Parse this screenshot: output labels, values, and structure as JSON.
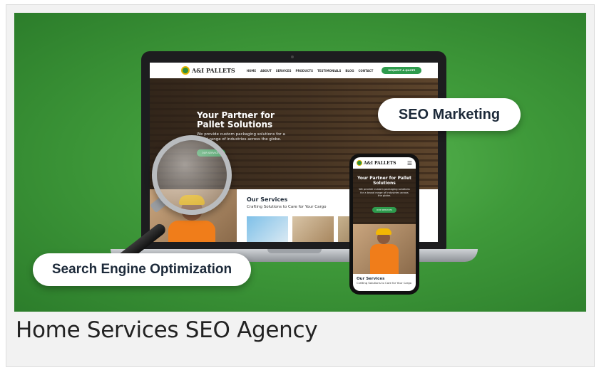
{
  "image": {
    "caption": "Home Services SEO Agency",
    "hero_bg_color": "#3f9a3a"
  },
  "badges": {
    "seo_marketing": "SEO Marketing",
    "search_engine_optimization": "Search Engine Optimization"
  },
  "laptop_site": {
    "logo": "A&I PALLETS",
    "nav": [
      "HOME",
      "ABOUT",
      "SERVICES",
      "PRODUCTS",
      "TESTIMONIALS",
      "BLOG",
      "CONTACT"
    ],
    "cta": "REQUEST A QUOTE",
    "hero_title": "Your Partner for Pallet Solutions",
    "hero_sub": "We provide custom packaging solutions for a broad range of industries across the globe.",
    "hero_button": "OUR SERVICES",
    "services_title": "Our Services",
    "services_sub": "Crafting Solutions to Care for Your Cargo"
  },
  "phone_site": {
    "logo": "A&I PALLETS",
    "hero_title": "Your Partner for Pallet Solutions",
    "hero_sub": "We provide custom packaging solutions for a broad range of industries across the globe.",
    "hero_button": "OUR SERVICES",
    "services_title": "Our Services",
    "services_sub": "Crafting Solutions to Care for Your Cargo"
  },
  "colors": {
    "brand_green": "#2e9b4d",
    "vest_orange": "#f07d1a",
    "hat_yellow": "#f2b705"
  }
}
